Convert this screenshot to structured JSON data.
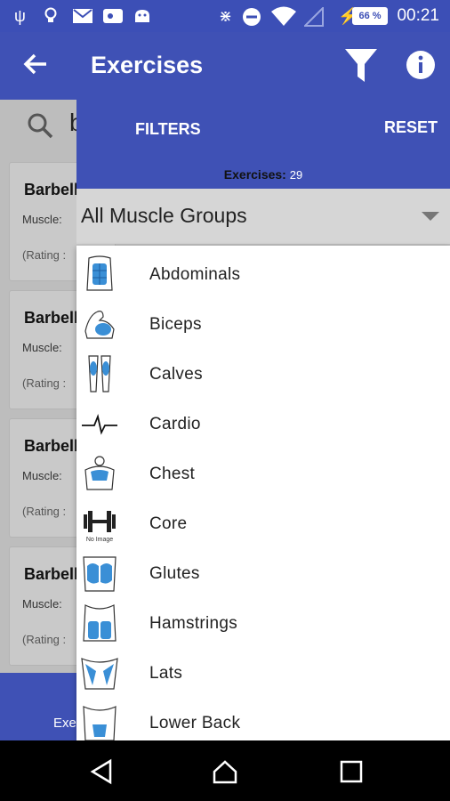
{
  "status_bar": {
    "time": "00:21",
    "battery": "66 %",
    "icons": [
      "usb-icon",
      "lightbulb-icon",
      "mail-icon",
      "voicemail-icon",
      "android-icon",
      "bluetooth-icon",
      "do-not-disturb-icon",
      "wifi-icon",
      "signal-icon",
      "charging-icon"
    ]
  },
  "appbar": {
    "title": "Exercises",
    "back_icon": "arrow-back-icon",
    "filter_icon": "funnel-icon",
    "info_icon": "info-icon",
    "color": "#3f51b5"
  },
  "background_list": {
    "search_text": "b",
    "cards": [
      {
        "title": "Barbell",
        "muscle": "Muscle:",
        "rating": "(Rating :"
      },
      {
        "title": "Barbell",
        "muscle": "Muscle:",
        "rating": "(Rating :"
      },
      {
        "title": "Barbell",
        "muscle": "Muscle:",
        "rating": "(Rating :"
      },
      {
        "title": "Barbell",
        "muscle": "Muscle:",
        "rating": "(Rating :"
      }
    ],
    "bottom_text": "Exe"
  },
  "drawer": {
    "filters_label": "FILTERS",
    "reset_label": "RESET",
    "count_label": "Exercises:",
    "count_value": "29",
    "spinner_value": "All Muscle Groups",
    "options": [
      {
        "label": "Abdominals",
        "icon": "abdominals-icon"
      },
      {
        "label": "Biceps",
        "icon": "biceps-icon"
      },
      {
        "label": "Calves",
        "icon": "calves-icon"
      },
      {
        "label": "Cardio",
        "icon": "heartbeat-icon"
      },
      {
        "label": "Chest",
        "icon": "chest-icon"
      },
      {
        "label": "Core",
        "icon": "dumbbell-icon",
        "caption": "No Image"
      },
      {
        "label": "Glutes",
        "icon": "glutes-icon"
      },
      {
        "label": "Hamstrings",
        "icon": "hamstrings-icon"
      },
      {
        "label": "Lats",
        "icon": "lats-icon"
      },
      {
        "label": "Lower Back",
        "icon": "lower-back-icon"
      }
    ]
  },
  "nav_bar": {
    "back": "nav-back-icon",
    "home": "nav-home-icon",
    "recents": "nav-recents-icon"
  }
}
